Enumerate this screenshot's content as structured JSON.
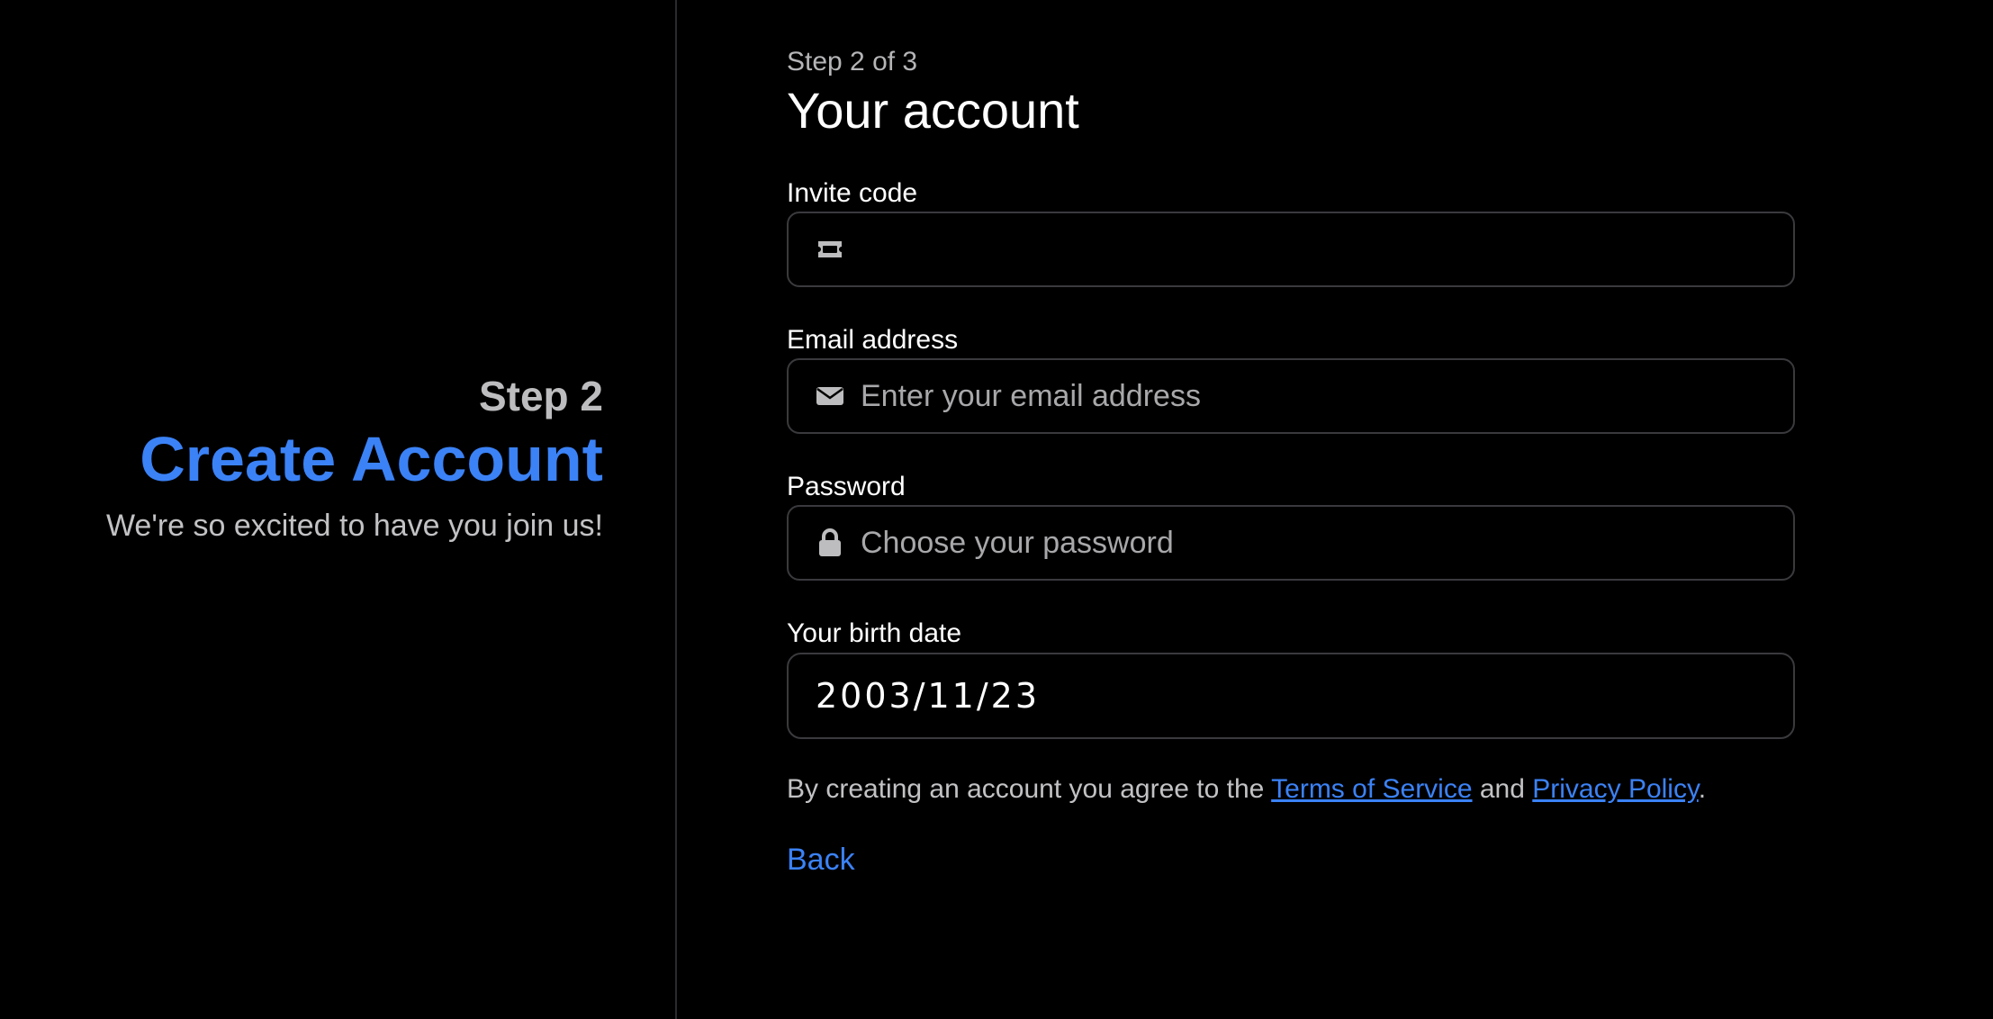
{
  "left": {
    "step_label": "Step 2",
    "title": "Create Account",
    "subtitle": "We're so excited to have you join us!"
  },
  "form": {
    "step_indicator": "Step 2 of 3",
    "title": "Your account",
    "invite_code": {
      "label": "Invite code",
      "icon": "ticket-icon",
      "value": "",
      "placeholder": ""
    },
    "email": {
      "label": "Email address",
      "icon": "envelope-icon",
      "value": "",
      "placeholder": "Enter your email address"
    },
    "password": {
      "label": "Password",
      "icon": "lock-icon",
      "value": "",
      "placeholder": "Choose your password"
    },
    "birth_date": {
      "label": "Your birth date",
      "value": "2003/11/23"
    },
    "legal": {
      "prefix": "By creating an account you agree to the ",
      "terms_link": "Terms of Service",
      "middle": " and ",
      "privacy_link": "Privacy Policy",
      "suffix": "."
    },
    "back_label": "Back"
  },
  "colors": {
    "background": "#000000",
    "accent": "#3b82f6",
    "muted_text": "#bdbdbf",
    "border": "#3a3a3e"
  }
}
